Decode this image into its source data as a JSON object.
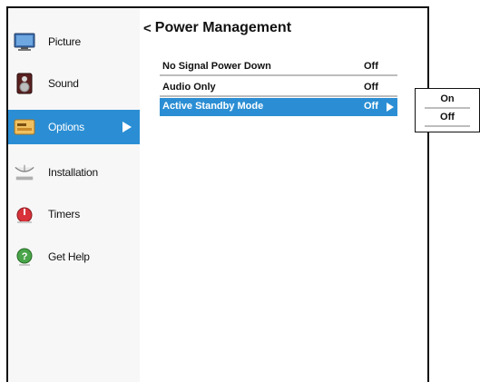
{
  "sidebar": {
    "items": [
      {
        "label": "Picture",
        "icon": "tv-icon"
      },
      {
        "label": "Sound",
        "icon": "speaker-icon"
      },
      {
        "label": "Options",
        "icon": "options-icon"
      },
      {
        "label": "Installation",
        "icon": "satellite-dish-icon"
      },
      {
        "label": "Timers",
        "icon": "timer-icon"
      },
      {
        "label": "Get Help",
        "icon": "help-icon"
      }
    ],
    "active_index": 2
  },
  "main": {
    "back_glyph": "<",
    "title": "Power Management",
    "rows": [
      {
        "name": "No Signal Power Down",
        "value": "Off"
      },
      {
        "name": "Audio Only",
        "value": "Off"
      },
      {
        "name": "Active Standby Mode",
        "value": "Off"
      }
    ],
    "selected_index": 2
  },
  "popup": {
    "options": [
      "On",
      "Off"
    ]
  },
  "colors": {
    "accent": "#2b8ed4",
    "divider": "#bdbdbd",
    "sidebar_bg": "#f7f7f7"
  }
}
